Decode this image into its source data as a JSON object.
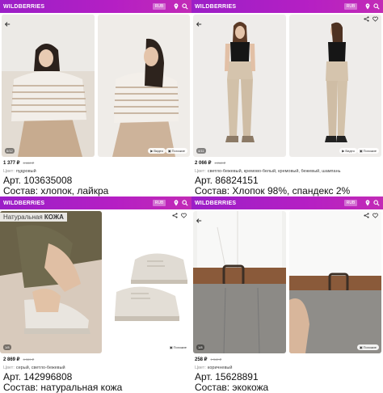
{
  "app": {
    "brand": "WILDBERRIES",
    "region_badge": "RUB"
  },
  "listings": [
    {
      "price": "1 377 ₽",
      "old_price": "6 888 ₽",
      "color_label": "Цвет:",
      "color_value": "пудровый",
      "article": "Арт. 103635008",
      "composition": "Состав: хлопок, лайкра",
      "counter": "6/12",
      "chip_video": "Видео",
      "chip_similar": "Похожие",
      "photo_palette": [
        "#d9ccc0",
        "#c9b7a6"
      ]
    },
    {
      "price": "2 066 ₽",
      "old_price": "4 268 ₽",
      "color_label": "Цвет:",
      "color_value": "светло-бежевый, кремово-белый, кремовый, бежевый, шампань",
      "article": "Арт. 86824151",
      "composition": "Состав: Хлопок 98%, спандекс 2%",
      "counter": "4/11",
      "chip_video": "Видео",
      "chip_similar": "Похожие",
      "photo_palette": [
        "#e9e6e2",
        "#cdbfa9"
      ]
    },
    {
      "price": "2 869 ₽",
      "old_price": "6 389 ₽",
      "color_label": "Цвет:",
      "color_value": "серый, светло-бежевый",
      "article": "Арт. 142996808",
      "composition": "Состав: натуральная кожа",
      "counter": "1/8",
      "chip_similar": "Похожие",
      "banner_prefix": "Натуральная",
      "banner_bold": "КОЖА",
      "photo_palette": [
        "#d4c6b8",
        "#e5e2de"
      ]
    },
    {
      "price": "258 ₽",
      "old_price": "1 342 ₽",
      "color_label": "Цвет:",
      "color_value": "коричневый",
      "article": "Арт. 15628891",
      "composition": "Состав: экокожа",
      "counter": "1/8",
      "chip_similar": "Похожие",
      "photo_palette": [
        "#e8e8e6",
        "#8a6243"
      ]
    }
  ]
}
